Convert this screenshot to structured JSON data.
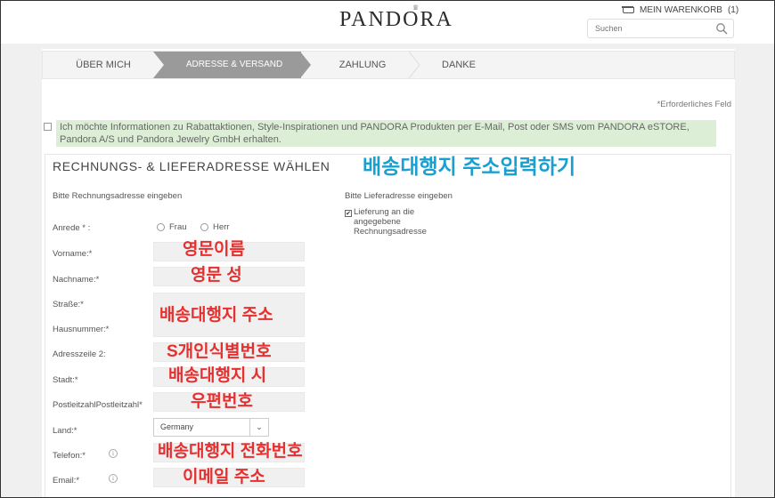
{
  "header": {
    "logo": "PANDORA",
    "cart_label": "MEIN WARENKORB",
    "cart_count": "(1)",
    "search_placeholder": "Suchen"
  },
  "steps": [
    {
      "label": "ÜBER MICH",
      "active": false
    },
    {
      "label": "ADRESSE & VERSAND",
      "active": true
    },
    {
      "label": "ZAHLUNG",
      "active": false
    },
    {
      "label": "DANKE",
      "active": false
    }
  ],
  "required_note": "*Erforderliches Feld",
  "newsletter": {
    "text": "Ich möchte Informationen zu Rabattaktionen, Style-Inspirationen und PANDORA Produkten per E-Mail, Post oder SMS vom PANDORA eSTORE, Pandora A/S und Pandora Jewelry GmbH erhalten.",
    "checked": false
  },
  "section": {
    "title": "RECHNUNGS- & LIEFERADRESSE WÄHLEN",
    "billing_heading": "Bitte Rechnungsadresse eingeben",
    "shipping_heading": "Bitte Lieferadresse eingeben",
    "same_address_label": "Lieferung an die angegebene Rechnungsadresse",
    "same_address_checked": true
  },
  "form": {
    "salutation_label": "Anrede * :",
    "salutation_options": [
      "Frau",
      "Herr"
    ],
    "firstname_label": "Vorname:*",
    "lastname_label": "Nachname:*",
    "street_label": "Straße:*",
    "housenumber_label": "Hausnummer:*",
    "address2_label": "Adresszeile 2:",
    "city_label": "Stadt:*",
    "zip_label": "PostleitzahlPostleitzahl*",
    "country_label": "Land:*",
    "country_value": "Germany",
    "phone_label": "Telefon:*",
    "email_label": "Email:*"
  },
  "annotations": {
    "title": "배송대행지 주소입력하기",
    "firstname": "영문이름",
    "lastname": "영문 성",
    "street": "배송대행지 주소",
    "address2": "S개인식별번호",
    "city": "배송대행지 시",
    "zip": "우편번호",
    "phone": "배송대행지 전화번호",
    "email": "이메일 주소",
    "title_color": "#1aa0d0",
    "note_color": "#e53030"
  },
  "colors": {
    "active_step": "#9a9a9a",
    "newsletter_bg": "#dcefd6"
  },
  "icons": {
    "cart": "cart-icon",
    "search": "search-icon",
    "info": "info-icon",
    "dropdown": "chevron-down-icon"
  }
}
